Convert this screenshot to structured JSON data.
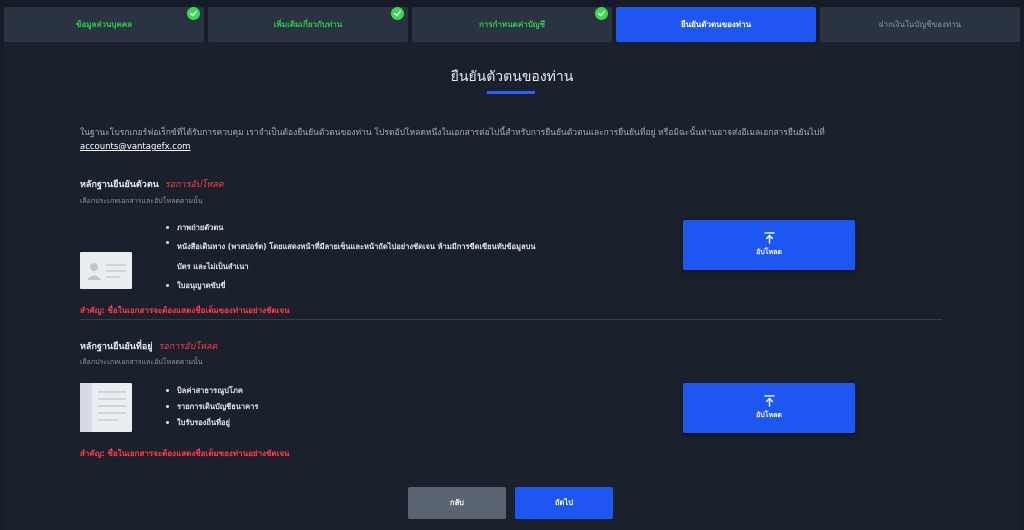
{
  "steps": [
    {
      "label": "ข้อมูลส่วนบุคคล",
      "status": "completed"
    },
    {
      "label": "เพิ่มเติมเกี่ยวกับท่าน",
      "status": "completed"
    },
    {
      "label": "การกำหนดค่าบัญชี",
      "status": "completed"
    },
    {
      "label": "ยืนยันตัวตนของท่าน",
      "status": "active"
    },
    {
      "label": "ฝากเงินในบัญชีของท่าน",
      "status": "pending"
    }
  ],
  "page_title": "ยืนยันตัวตนของท่าน",
  "intro_text": "ในฐานะโบรกเกอร์ฟอเร็กซ์ที่ได้รับการควบคุม เราจำเป็นต้องยืนยันตัวตนของท่าน โปรดอัปโหลดหนึ่งในเอกสารต่อไปนี้สำหรับการยืนยันตัวตนและการยืนยันที่อยู่ หรือมิฉะนั้นท่านอาจส่งอีเมลเอกสารยืนยันไปที่",
  "intro_email": "accounts@vantagefx.com",
  "identity": {
    "title": "หลักฐานยืนยันตัวตน",
    "status": "รอการอัปโหลด",
    "subtitle": "เลือกประเภทเอกสารและอัปโหลดตามนั้น",
    "items": [
      "ภาพถ่ายตัวตน",
      "หนังสือเดินทาง (พาสปอร์ต) โดยแสดงหน้าที่มีลายเซ็นและหน้าถัดไปอย่างชัดเจน ห้ามมีการขีดเขียนทับข้อมูลบนบัตร และไม่เป็นสำเนา",
      "ใบอนุญาตขับขี่"
    ],
    "upload_label": "อัปโหลด",
    "warning": "สำคัญ: ชื่อในเอกสารจะต้องแสดงชื่อเต็มของท่านอย่างชัดเจน"
  },
  "address": {
    "title": "หลักฐานยืนยันที่อยู่",
    "status": "รอการอัปโหลด",
    "subtitle": "เลือกประเภทเอกสารและอัปโหลดตามนั้น",
    "items": [
      "บิลค่าสาธารณูปโภค",
      "รายการเดินบัญชีธนาคาร",
      "ใบรับรองถิ่นที่อยู่"
    ],
    "upload_label": "อัปโหลด",
    "warning": "สำคัญ: ชื่อในเอกสารจะต้องแสดงชื่อเต็มของท่านอย่างชัดเจน"
  },
  "buttons": {
    "back": "กลับ",
    "next": "ถัดไป"
  },
  "colors": {
    "accent": "#1d56f0",
    "success": "#3dd654",
    "warning": "#ff3b4c",
    "background": "#161c27"
  },
  "icons": {
    "step_check": "check-circle-icon",
    "upload": "upload-arrow-icon",
    "id_card": "id-card-icon",
    "address_doc": "document-icon"
  }
}
